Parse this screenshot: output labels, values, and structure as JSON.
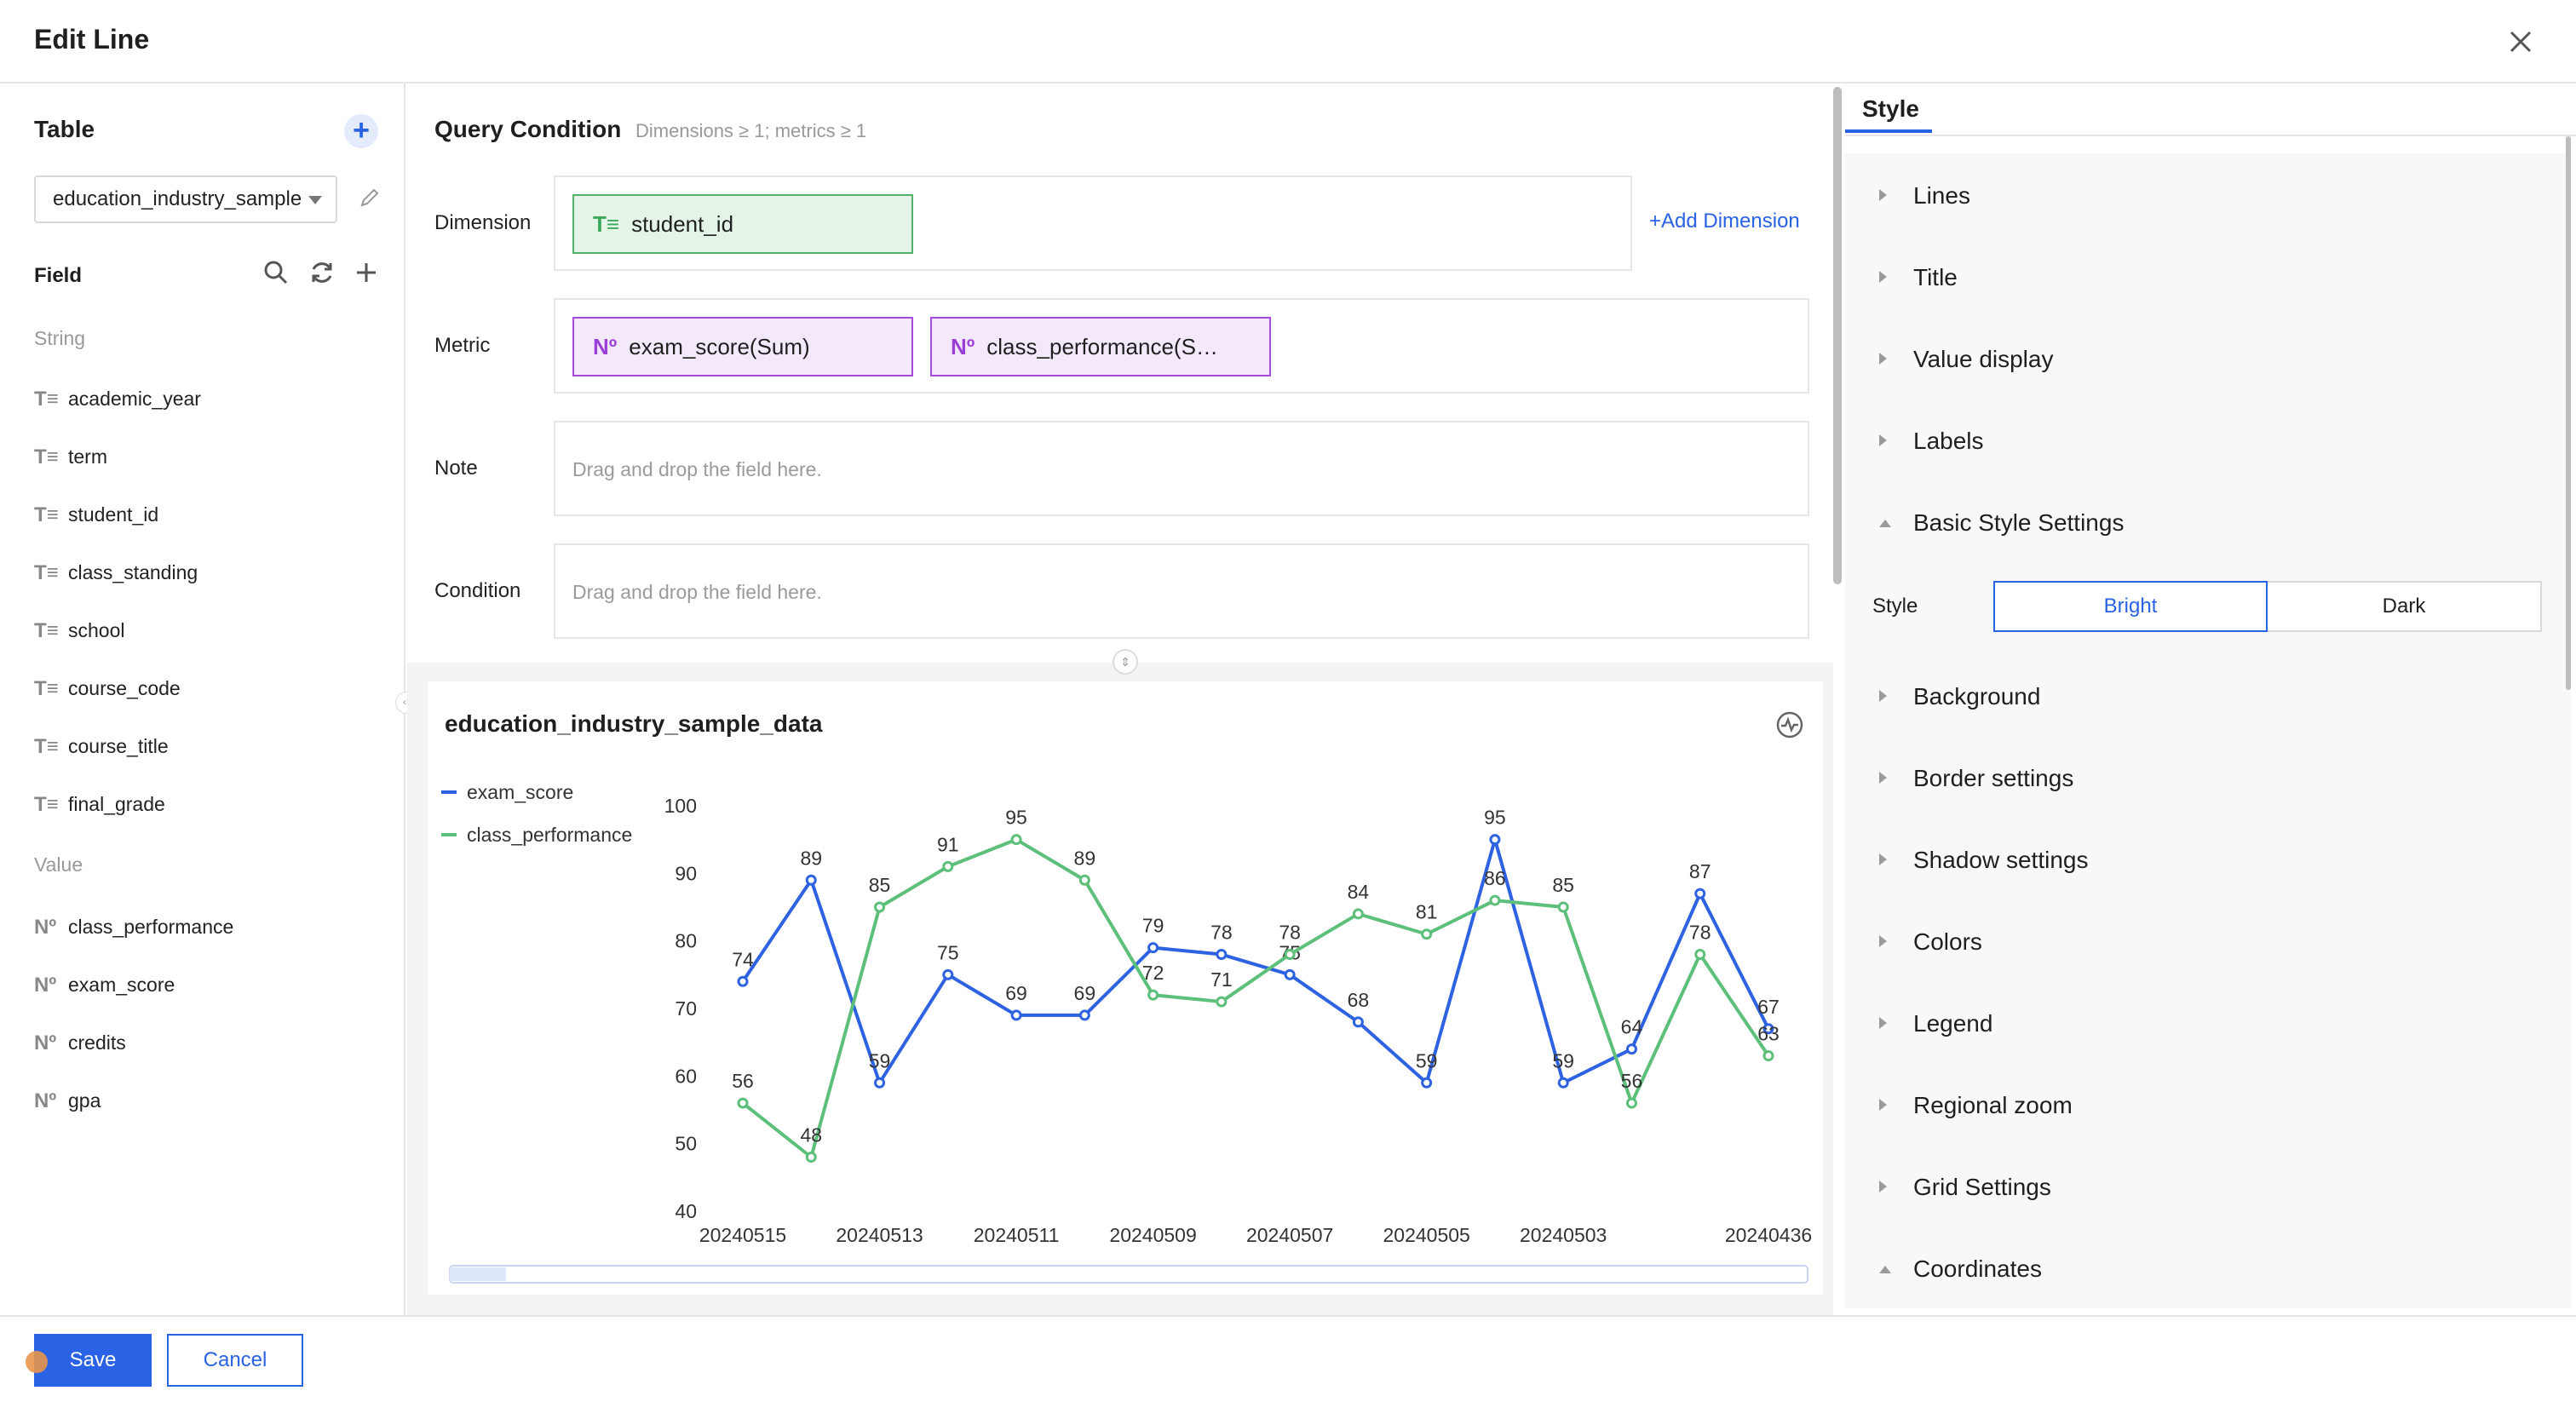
{
  "dialog": {
    "title": "Edit Line"
  },
  "left": {
    "table_heading": "Table",
    "table_select": "education_industry_sample",
    "field_heading": "Field",
    "string_group": "String",
    "string_fields": [
      "academic_year",
      "term",
      "student_id",
      "class_standing",
      "school",
      "course_code",
      "course_title",
      "final_grade"
    ],
    "value_group": "Value",
    "value_fields": [
      "class_performance",
      "exam_score",
      "credits",
      "gpa"
    ],
    "string_icon": "T≡",
    "value_icon": "Nº"
  },
  "query": {
    "title": "Query Condition",
    "subtitle": "Dimensions ≥ 1; metrics ≥ 1",
    "dimension_label": "Dimension",
    "dimension_pill": "student_id",
    "add_dimension": "Add Dimension",
    "metric_label": "Metric",
    "metric_pills": [
      "exam_score(Sum)",
      "class_performance(S…"
    ],
    "note_label": "Note",
    "note_placeholder": "Drag and drop the field here.",
    "condition_label": "Condition",
    "condition_placeholder": "Drag and drop the field here."
  },
  "chart_data": {
    "type": "line",
    "title": "education_industry_sample_data",
    "categories": [
      "20240515",
      "",
      "20240513",
      "",
      "20240511",
      "",
      "20240509",
      "",
      "20240507",
      "",
      "20240505",
      "",
      "20240503",
      "",
      "",
      "20240436"
    ],
    "x_tick_labels": [
      "20240515",
      "20240513",
      "20240511",
      "20240509",
      "20240507",
      "20240505",
      "20240503",
      "20240436"
    ],
    "series": [
      {
        "name": "exam_score",
        "color": "#2d62e0",
        "values": [
          74,
          89,
          59,
          75,
          69,
          69,
          79,
          78,
          75,
          68,
          59,
          95,
          59,
          64,
          87,
          67
        ]
      },
      {
        "name": "class_performance",
        "color": "#5cbf7a",
        "values": [
          56,
          48,
          85,
          91,
          95,
          89,
          72,
          71,
          78,
          84,
          81,
          86,
          85,
          56,
          78,
          63
        ]
      }
    ],
    "ylim": [
      40,
      100
    ],
    "yticks": [
      40,
      50,
      60,
      70,
      80,
      90,
      100
    ],
    "legend_position": "top-left",
    "grid": false
  },
  "style_panel": {
    "tab": "Style",
    "items_top": [
      "Lines",
      "Title",
      "Value display",
      "Labels",
      "Basic Style Settings"
    ],
    "style_label": "Style",
    "style_options": [
      "Bright",
      "Dark"
    ],
    "style_selected": "Bright",
    "items_bottom": [
      "Background",
      "Border settings",
      "Shadow settings",
      "Colors",
      "Legend",
      "Regional zoom",
      "Grid Settings",
      "Coordinates"
    ]
  },
  "footer": {
    "save": "Save",
    "cancel": "Cancel"
  },
  "colors": {
    "primary": "#2a62e6",
    "dimension": "#52b26d",
    "metric": "#a44bd9"
  }
}
